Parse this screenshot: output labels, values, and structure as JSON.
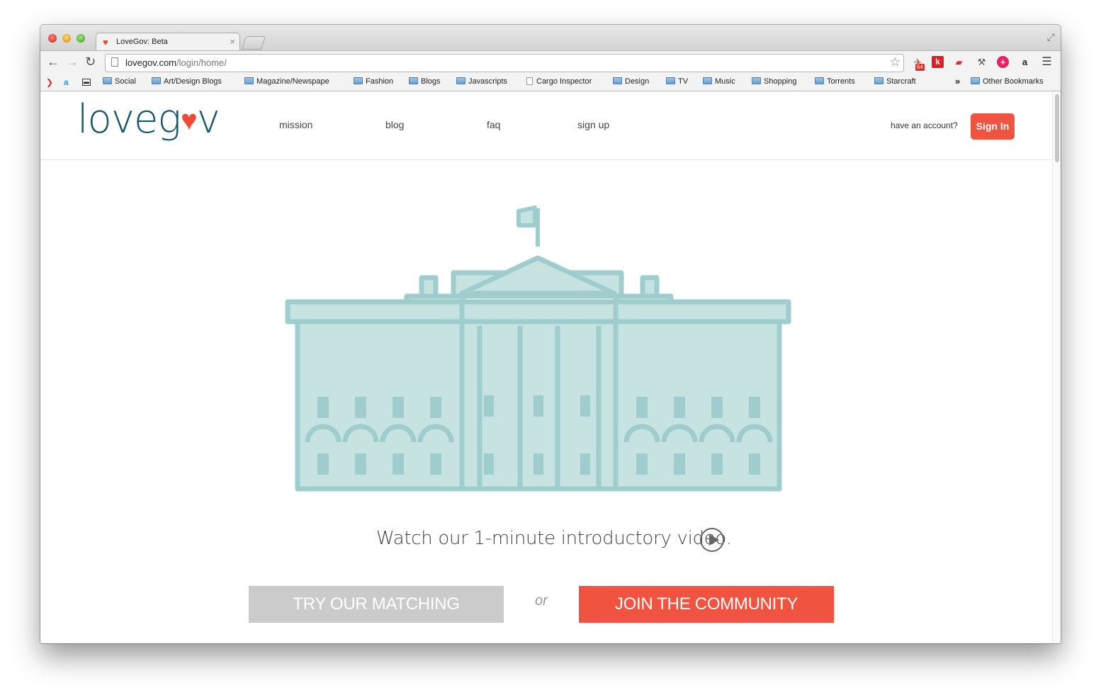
{
  "browser": {
    "tab_title": "LoveGov: Beta",
    "tab_close": "×",
    "url_domain": "lovegov.com",
    "url_path": "/login/home/",
    "extension_badge": "64",
    "extension_k": "k",
    "extension_a": "a",
    "bookmarks": [
      {
        "label": "Social",
        "type": "folder"
      },
      {
        "label": "Art/Design Blogs",
        "type": "folder"
      },
      {
        "label": "Magazine/Newspape",
        "type": "folder"
      },
      {
        "label": "Fashion",
        "type": "folder"
      },
      {
        "label": "Blogs",
        "type": "folder"
      },
      {
        "label": "Javascripts",
        "type": "folder"
      },
      {
        "label": "Cargo Inspector",
        "type": "page"
      },
      {
        "label": "Design",
        "type": "folder"
      },
      {
        "label": "TV",
        "type": "folder"
      },
      {
        "label": "Music",
        "type": "folder"
      },
      {
        "label": "Shopping",
        "type": "folder"
      },
      {
        "label": "Torrents",
        "type": "folder"
      },
      {
        "label": "Starcraft",
        "type": "folder"
      }
    ],
    "bookmarks_overflow": "»",
    "other_bookmarks": "Other Bookmarks"
  },
  "site": {
    "logo_prefix": "loveg",
    "logo_suffix": "v",
    "nav": [
      "mission",
      "blog",
      "faq",
      "sign up"
    ],
    "have_account": "have an account?",
    "signin_label": "Sign In",
    "video_text": "Watch our 1-minute introductory video.",
    "cta_try": "TRY OUR MATCHING",
    "or": "or",
    "cta_join": "JOIN THE COMMUNITY"
  },
  "colors": {
    "brand_red": "#f15341",
    "brand_teal": "#17566a",
    "building_fill": "#c6e3e2",
    "building_stroke": "#9fcdcd",
    "cta_gray": "#cbcbcb"
  }
}
